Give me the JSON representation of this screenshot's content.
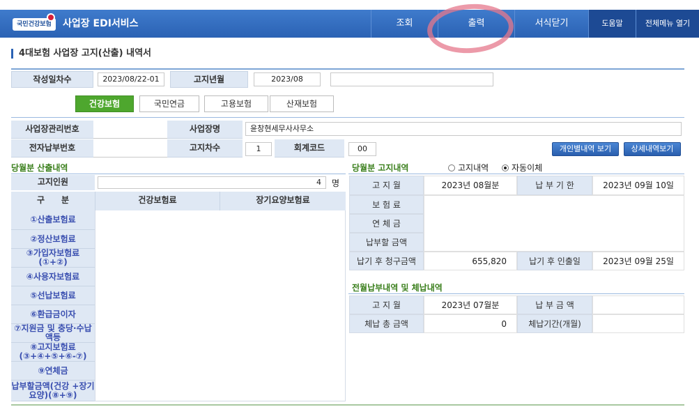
{
  "header": {
    "logo": "국민건강보험",
    "app_title": "사업장 EDI서비스",
    "nav": [
      "조회",
      "출력",
      "서식닫기",
      "도움말",
      "전체메뉴 열기"
    ]
  },
  "page_title": "4대보험 사업장 고지(산출) 내역서",
  "top": {
    "create_label": "작성일차수",
    "create_value": "2023/08/22-01",
    "month_label": "고지년월",
    "month_value": "2023/08"
  },
  "tabs": [
    "건강보험",
    "국민연금",
    "고용보험",
    "산재보험"
  ],
  "info": {
    "mgmt_label": "사업장관리번호",
    "mgmt_value": "",
    "name_label": "사업장명",
    "name_value": "윤창현세무사사무소",
    "epay_label": "전자납부번호",
    "epay_value": "",
    "seq_label": "고지차수",
    "seq_value": "1",
    "acct_label": "회계코드",
    "acct_value": "00",
    "btn_personal": "개인별내역 보기",
    "btn_detail": "상세내역보기"
  },
  "left": {
    "section": "당월분 산출내역",
    "count_label": "고지인원",
    "count_value": "4",
    "count_unit": "명",
    "col_div": "구　　분",
    "col_health": "건강보험료",
    "col_ltc": "장기요양보험료",
    "rows": [
      "①산출보험료",
      "②정산보험료",
      "③가입자보험료 (①+②)",
      "④사용자보험료",
      "⑤선납보험료",
      "⑥환급금이자",
      "⑦지원금 및 충당·수납액등",
      "⑧고지보험료 (③+④+⑤+⑥-⑦)",
      "⑨연체금",
      "납부할금액(건강 +장기요양)(⑧+⑨)"
    ]
  },
  "right": {
    "section": "당월분 고지내역",
    "radio1": "고지내역",
    "radio2": "자동이체",
    "month_label": "고 지 월",
    "month_value": "2023년 08월분",
    "due_label": "납 부 기 한",
    "due_value": "2023년 09월 10일",
    "prem_label": "보 험 료",
    "late_label": "연 체 금",
    "pay_label": "납부할 금액",
    "after_label": "납기 후 청구금액",
    "after_value": "655,820",
    "after_date_label": "납기 후 인출일",
    "after_date_value": "2023년 09월 25일",
    "prev_section": "전월납부내역 및 체납내역",
    "prev_month_label": "고 지 월",
    "prev_month_value": "2023년 07월분",
    "prev_amt_label": "납 부 금 액",
    "prev_amt_value": "",
    "arrears_label": "체납 총 금액",
    "arrears_value": "0",
    "arrears_period_label": "체납기간(개월)",
    "arrears_period_value": ""
  }
}
